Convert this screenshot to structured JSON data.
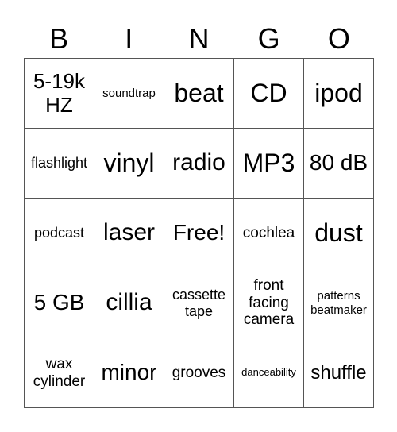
{
  "header": [
    "B",
    "I",
    "N",
    "G",
    "O"
  ],
  "rows": [
    [
      "5-19k HZ",
      "soundtrap",
      "beat",
      "CD",
      "ipod"
    ],
    [
      "flashlight",
      "vinyl",
      "radio",
      "MP3",
      "80 dB"
    ],
    [
      "podcast",
      "laser",
      "Free!",
      "cochlea",
      "dust"
    ],
    [
      "5 GB",
      "cillia",
      "cassette tape",
      "front facing camera",
      "patterns beatmaker"
    ],
    [
      "wax cylinder",
      "minor",
      "grooves",
      "danceability",
      "shuffle"
    ]
  ]
}
